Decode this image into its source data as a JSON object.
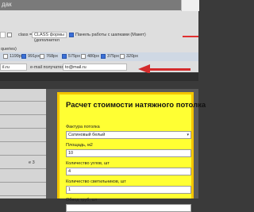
{
  "titlebar": {
    "text": "дак"
  },
  "controls": {
    "class_label": "class =",
    "class_dropdown_value": "CLASS формы (дополнител",
    "panel_checkbox_checked": true,
    "panel_label": "Панель работы с шапками (Макет)"
  },
  "breakpoints": {
    "partial_label": "queries)",
    "options": [
      {
        "label": "1199px",
        "selected": false
      },
      {
        "label": "991px",
        "selected": true
      },
      {
        "label": "768px",
        "selected": false
      },
      {
        "label": "575px",
        "selected": true
      },
      {
        "label": "480px",
        "selected": false
      },
      {
        "label": "375px",
        "selected": true
      },
      {
        "label": "320px",
        "selected": false
      }
    ]
  },
  "email_row": {
    "left_value": "il.ru",
    "recipient_label": "e-mail получателя",
    "recipient_value": "to@mail.ru"
  },
  "sidebar": {
    "items": [
      "",
      "",
      "",
      "",
      "",
      "е 3",
      "",
      ""
    ]
  },
  "calculator": {
    "title": "Расчет стоимости натяжного потолка",
    "fields": [
      {
        "label": "Фактура потолка",
        "value": "Сатиновый белый",
        "type": "select"
      },
      {
        "label": "Площадь, м2",
        "value": "10",
        "type": "input"
      },
      {
        "label": "Количество углов, шт",
        "value": "4",
        "type": "input"
      },
      {
        "label": "Количество светильников, шт",
        "value": "1",
        "type": "input"
      },
      {
        "label": "Обвод труб, шт",
        "value": "",
        "type": "input"
      }
    ]
  },
  "colors": {
    "calc_background": "#ffff33",
    "calc_border": "#f4c400",
    "arrow": "#d42b2b",
    "checkbox_selected": "#3a6fd8"
  }
}
